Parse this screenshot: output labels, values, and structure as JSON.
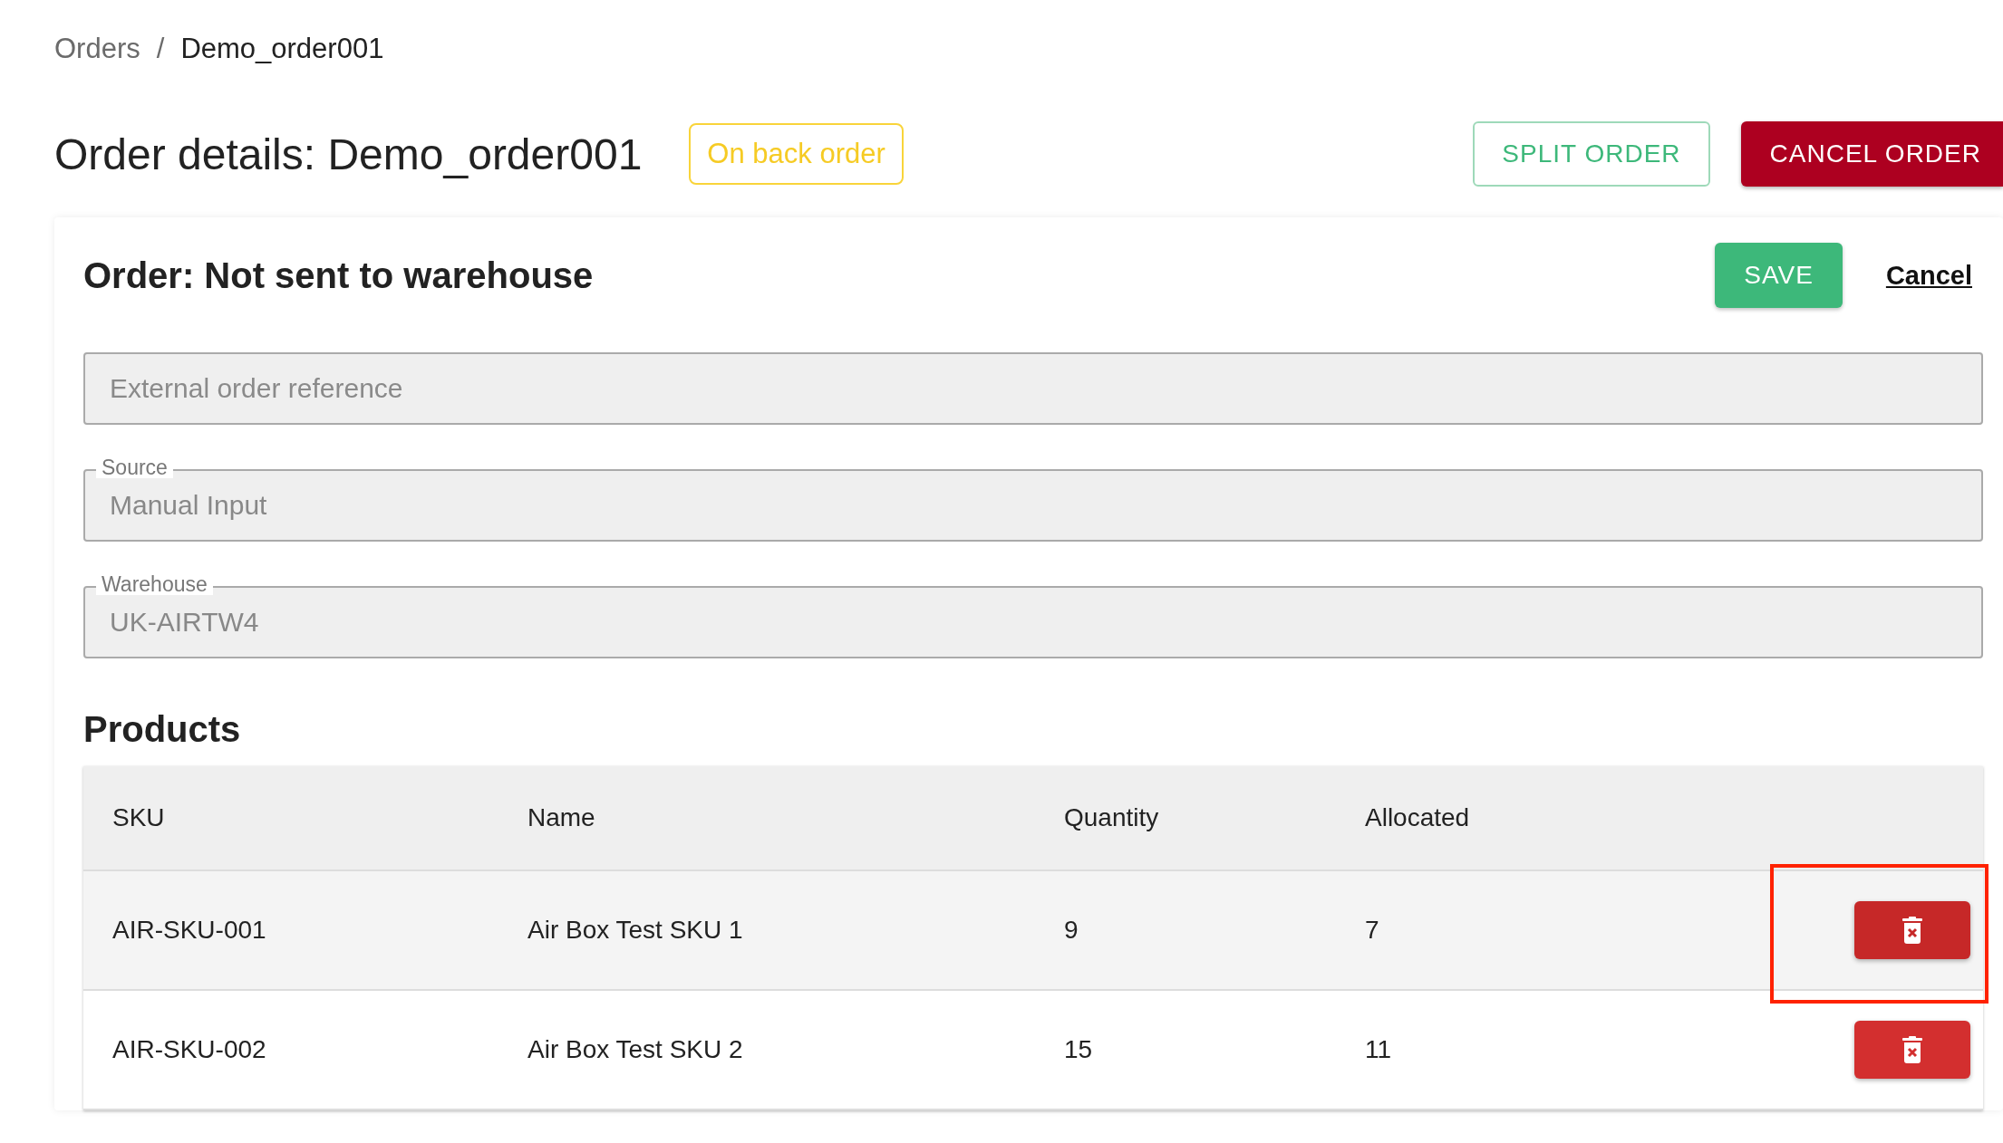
{
  "breadcrumb": [
    {
      "label": "Orders"
    },
    {
      "label": "Demo_order001"
    }
  ],
  "breadcrumb_separator": "/",
  "header": {
    "title": "Order details: Demo_order001",
    "status_badge": "On back order",
    "buttons": [
      {
        "label": "SPLIT ORDER",
        "kind": "outlined"
      },
      {
        "label": "CANCEL ORDER",
        "kind": "danger"
      }
    ]
  },
  "card": {
    "title": "Order: Not sent to warehouse",
    "save_button": "SAVE",
    "cancel_link": "Cancel",
    "fields": [
      {
        "placeholder": "External order reference"
      },
      {
        "label": "Source",
        "value": "Manual Input"
      },
      {
        "label": "Warehouse",
        "value": "UK-AIRTW4"
      }
    ]
  },
  "products": {
    "title": "Products",
    "columns": [
      "SKU",
      "Name",
      "Quantity",
      "Allocated"
    ],
    "rows": [
      {
        "cells": [
          "AIR-SKU-001",
          "Air Box Test SKU 1",
          "9",
          "7"
        ],
        "hovered": true,
        "highlighted": true
      },
      {
        "cells": [
          "AIR-SKU-002",
          "Air Box Test SKU 2",
          "15",
          "11"
        ],
        "hovered": false,
        "highlighted": false
      }
    ]
  }
}
